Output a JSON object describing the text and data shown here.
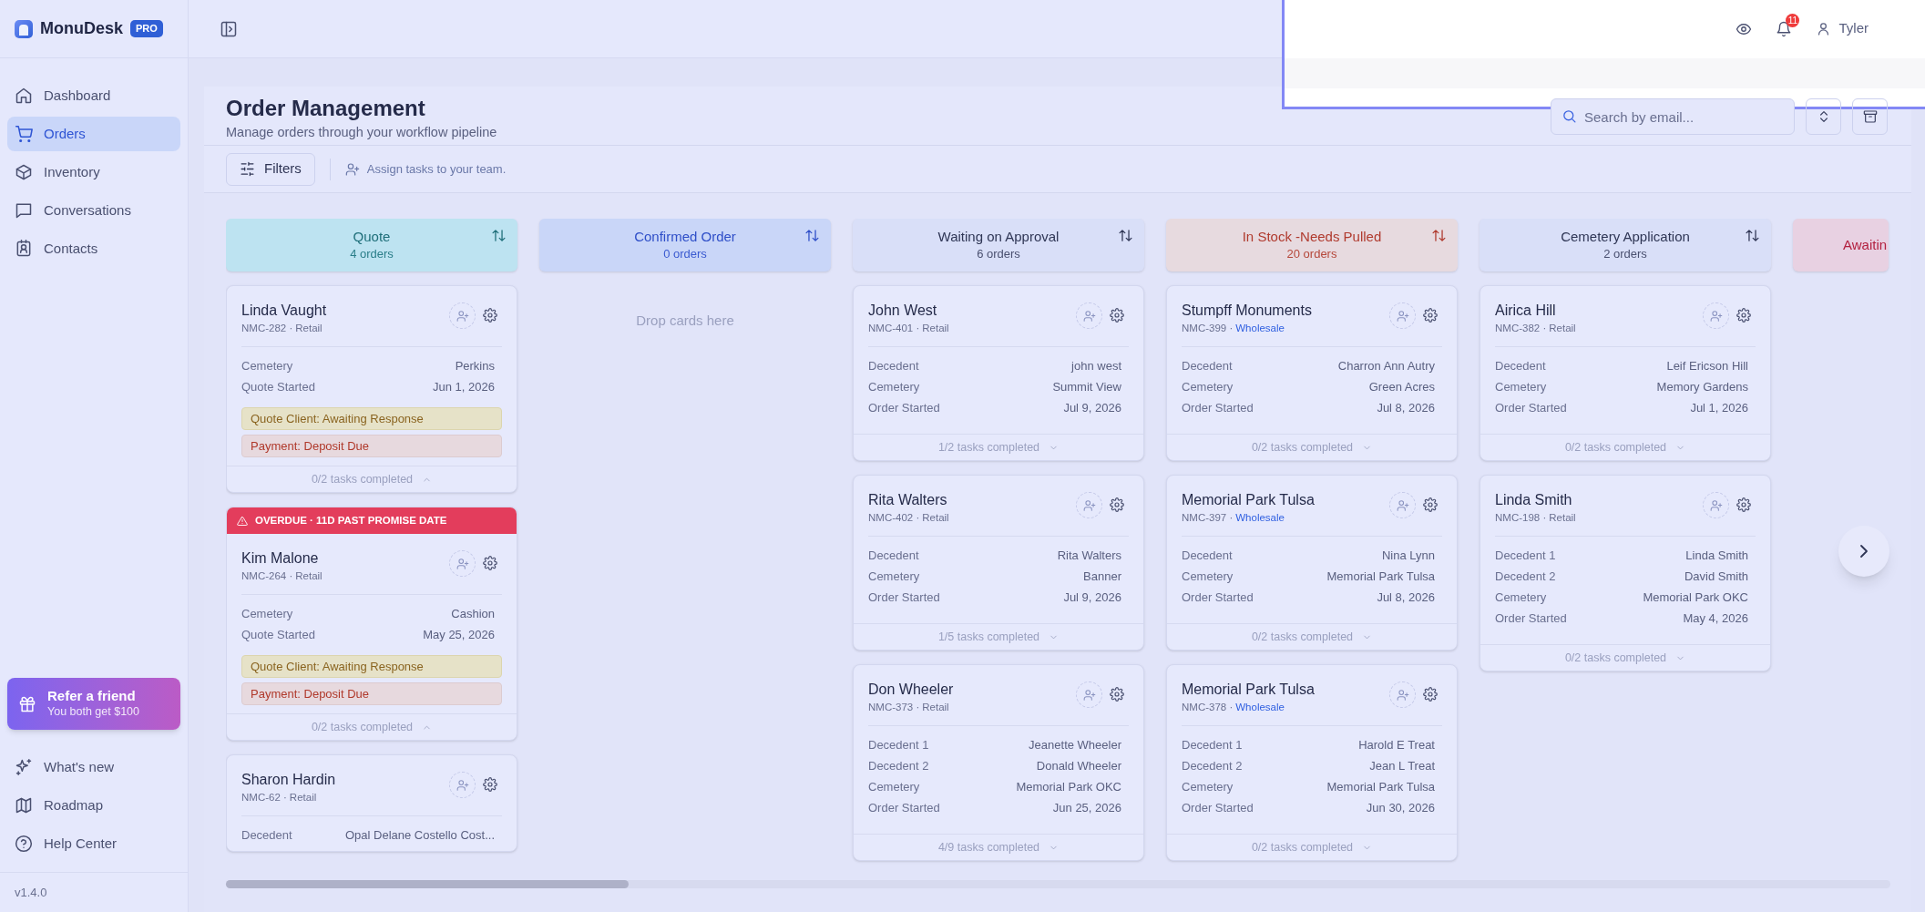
{
  "brand": {
    "name": "MonuDesk",
    "badge": "PRO"
  },
  "sidebar": {
    "items": [
      {
        "label": "Dashboard",
        "selected": false
      },
      {
        "label": "Orders",
        "selected": true
      },
      {
        "label": "Inventory",
        "selected": false
      },
      {
        "label": "Conversations",
        "selected": false
      },
      {
        "label": "Contacts",
        "selected": false
      }
    ],
    "promo": {
      "title": "Refer a friend",
      "subtitle": "You both get $100"
    },
    "footer_items": [
      {
        "label": "What's new"
      },
      {
        "label": "Roadmap"
      },
      {
        "label": "Help Center"
      }
    ],
    "version": "v1.4.0"
  },
  "topbar": {
    "notifications": "11",
    "user": "Tyler"
  },
  "page": {
    "title": "Order Management",
    "subtitle": "Manage orders through your workflow pipeline",
    "search": {
      "placeholder": "Search by email..."
    },
    "filters_button": "Filters",
    "hint": "Assign tasks to your team."
  },
  "columns": [
    {
      "title": "Quote",
      "count": "4 orders",
      "color": "#bde3f1",
      "cut": false,
      "cards": [
        {
          "name": "Linda Vaught",
          "code": "NMC-282 ·",
          "type": "Retail",
          "kind": "retail",
          "fields": [
            {
              "label": "Cemetery",
              "value": "Perkins"
            },
            {
              "label": "Quote Started",
              "value": "Jun 1, 2026"
            }
          ],
          "tags": [
            {
              "text": "Quote Client: Awaiting Response",
              "kind": "warning"
            },
            {
              "text": "Payment: Deposit Due",
              "kind": "danger"
            }
          ],
          "tasks": "0/2 tasks completed",
          "expanded": true
        },
        {
          "overdue": "OVERDUE · 11D PAST PROMISE DATE",
          "name": "Kim Malone",
          "code": "NMC-264 ·",
          "type": "Retail",
          "kind": "retail",
          "fields": [
            {
              "label": "Cemetery",
              "value": "Cashion"
            },
            {
              "label": "Quote Started",
              "value": "May 25, 2026"
            }
          ],
          "tags": [
            {
              "text": "Quote Client: Awaiting Response",
              "kind": "warning"
            },
            {
              "text": "Payment: Deposit Due",
              "kind": "danger"
            }
          ],
          "tasks": "0/2 tasks completed",
          "expanded": true
        },
        {
          "name": "Sharon Hardin",
          "code": "NMC-62 ·",
          "type": "Retail",
          "kind": "retail",
          "fields": [
            {
              "label": "Decedent",
              "value": "Opal Delane Costello Cost..."
            }
          ]
        }
      ]
    },
    {
      "title": "Confirmed Order",
      "count": "0 orders",
      "color": "#c9d6f8",
      "cut": false,
      "empty_text": "Drop cards here"
    },
    {
      "title": "Waiting on Approval",
      "count": "6 orders",
      "color": "#d9dff8",
      "cut": false,
      "cards": [
        {
          "name": "John West",
          "code": "NMC-401 ·",
          "type": "Retail",
          "kind": "retail",
          "fields": [
            {
              "label": "Decedent",
              "value": "john west"
            },
            {
              "label": "Cemetery",
              "value": "Summit View"
            },
            {
              "label": "Order Started",
              "value": "Jul 9, 2026"
            }
          ],
          "tasks": "1/2 tasks completed",
          "expanded": false
        },
        {
          "name": "Rita Walters",
          "code": "NMC-402 ·",
          "type": "Retail",
          "kind": "retail",
          "fields": [
            {
              "label": "Decedent",
              "value": "Rita Walters"
            },
            {
              "label": "Cemetery",
              "value": "Banner"
            },
            {
              "label": "Order Started",
              "value": "Jul 9, 2026"
            }
          ],
          "tasks": "1/5 tasks completed",
          "expanded": false
        },
        {
          "name": "Don Wheeler",
          "code": "NMC-373 ·",
          "type": "Retail",
          "kind": "retail",
          "fields": [
            {
              "label": "Decedent 1",
              "value": "Jeanette Wheeler"
            },
            {
              "label": "Decedent 2",
              "value": "Donald Wheeler"
            },
            {
              "label": "Cemetery",
              "value": "Memorial Park OKC"
            },
            {
              "label": "Order Started",
              "value": "Jun 25, 2026"
            }
          ],
          "tasks": "4/9 tasks completed",
          "expanded": false
        }
      ]
    },
    {
      "title": "In Stock -Needs Pulled",
      "count": "20 orders",
      "color": "#e7dadf",
      "cut": false,
      "cards": [
        {
          "name": "Stumpff Monuments",
          "code": "NMC-399 ·",
          "type": "Wholesale",
          "kind": "wholesale",
          "fields": [
            {
              "label": "Decedent",
              "value": "Charron Ann Autry"
            },
            {
              "label": "Cemetery",
              "value": "Green Acres"
            },
            {
              "label": "Order Started",
              "value": "Jul 8, 2026"
            }
          ],
          "tasks": "0/2 tasks completed",
          "expanded": false
        },
        {
          "name": "Memorial Park Tulsa",
          "code": "NMC-397 ·",
          "type": "Wholesale",
          "kind": "wholesale",
          "fields": [
            {
              "label": "Decedent",
              "value": "Nina Lynn"
            },
            {
              "label": "Cemetery",
              "value": "Memorial Park Tulsa"
            },
            {
              "label": "Order Started",
              "value": "Jul 8, 2026"
            }
          ],
          "tasks": "0/2 tasks completed",
          "expanded": false
        },
        {
          "name": "Memorial Park Tulsa",
          "code": "NMC-378 ·",
          "type": "Wholesale",
          "kind": "wholesale",
          "fields": [
            {
              "label": "Decedent 1",
              "value": "Harold E Treat"
            },
            {
              "label": "Decedent 2",
              "value": "Jean L Treat"
            },
            {
              "label": "Cemetery",
              "value": "Memorial Park Tulsa"
            },
            {
              "label": "Order Started",
              "value": "Jun 30, 2026"
            }
          ],
          "tasks": "0/2 tasks completed",
          "expanded": false
        }
      ]
    },
    {
      "title": "Cemetery Application",
      "count": "2 orders",
      "color": "#d9dff8",
      "cut": false,
      "cards": [
        {
          "name": "Airica Hill",
          "code": "NMC-382 ·",
          "type": "Retail",
          "kind": "retail",
          "fields": [
            {
              "label": "Decedent",
              "value": "Leif Ericson Hill"
            },
            {
              "label": "Cemetery",
              "value": "Memory Gardens"
            },
            {
              "label": "Order Started",
              "value": "Jul 1, 2026"
            }
          ],
          "tasks": "0/2 tasks completed",
          "expanded": false
        },
        {
          "name": "Linda Smith",
          "code": "NMC-198 ·",
          "type": "Retail",
          "kind": "retail",
          "fields": [
            {
              "label": "Decedent 1",
              "value": "Linda Smith"
            },
            {
              "label": "Decedent 2",
              "value": "David Smith"
            },
            {
              "label": "Cemetery",
              "value": "Memorial Park OKC"
            },
            {
              "label": "Order Started",
              "value": "May 4, 2026"
            }
          ],
          "tasks": "0/2 tasks completed",
          "expanded": false
        }
      ]
    },
    {
      "title": "Awaitin",
      "color": "#e8d1e2",
      "cut": true
    }
  ]
}
